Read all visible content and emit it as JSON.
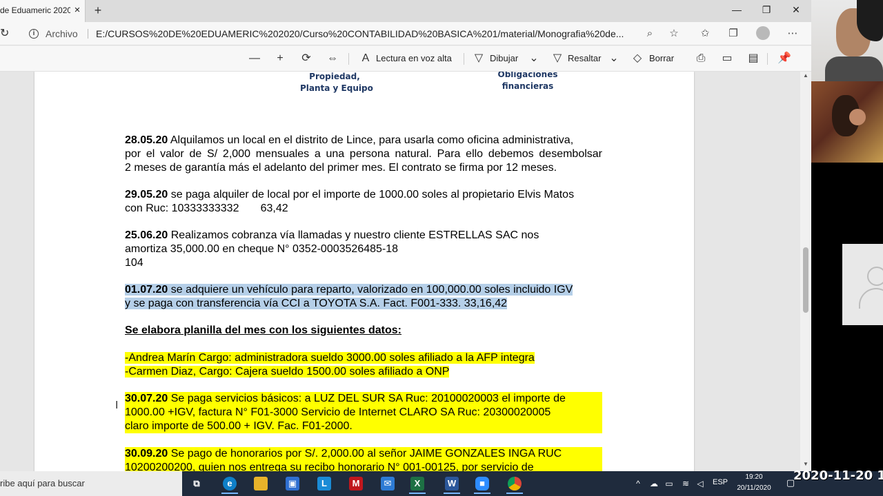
{
  "tab": {
    "title": "de Eduameric 2020",
    "close_glyph": "×",
    "new_tab_glyph": "+"
  },
  "window_controls": {
    "minimize": "—",
    "maximize": "❐",
    "close": "✕"
  },
  "address_bar": {
    "scheme_label": "Archivo",
    "url": "E:/CURSOS%20DE%20EDUAMERIC%202020/Curso%20CONTABILIDAD%20BASICA%201/material/Monografia%20de..."
  },
  "pdf_toolbar": {
    "zoom_out": "—",
    "zoom_in": "+",
    "read_aloud": "Lectura en voz alta",
    "draw": "Dibujar",
    "highlight": "Resaltar",
    "erase": "Borrar"
  },
  "document": {
    "diagram_labels": {
      "left": [
        "Propiedad,",
        "Planta y Equipo"
      ],
      "right": [
        "Obligaciones",
        "financieras"
      ]
    },
    "paragraphs": {
      "p1": {
        "date": "28.05.20",
        "line1": " Alquilamos un local en el distrito de Lince, para usarla como oficina administrativa,",
        "line2": "por el valor de S/ 2,000 mensuales a una persona natural. Para ello debemos desembolsar",
        "line3": "2 meses de garantía más el adelanto del primer mes. El contrato se firma por 12 meses."
      },
      "p2": {
        "date": "29.05.20",
        "line1": " se paga alquiler de local por el importe de 1000.00 soles al propietario Elvis Matos",
        "line2": "con Ruc: 10333333332       63,42"
      },
      "p3": {
        "date": "25.06.20",
        "line1": " Realizamos cobranza vía llamadas y nuestro cliente ESTRELLAS SAC nos",
        "line2": "amortiza 35,000.00 en cheque N° 0352-0003526485-18",
        "line3": "104"
      },
      "p4": {
        "date": "01.07.20",
        "line1": " se adquiere un vehículo para reparto, valorizado en 100,000.00 soles incluido IGV",
        "line2": "y se paga con transferencia vía CCI a TOYOTA S.A. Fact. F001-333. 33,16,42"
      },
      "heading": "Se elabora planilla del mes con los siguientes datos:",
      "p5": {
        "line1": "-Andrea Marín Cargo: administradora sueldo 3000.00 soles afiliado a la AFP integra",
        "line2": "-Carmen Diaz, Cargo: Cajera sueldo 1500.00 soles afiliado a ONP"
      },
      "p6": {
        "date": "30.07.20",
        "line1": " Se paga servicios básicos: a LUZ DEL SUR SA Ruc: 20100020003 el importe de",
        "line2": "1000.00 +IGV, factura N° F01-3000 Servicio de Internet CLARO SA Ruc: 20300020005",
        "line3": "claro importe de 500.00 + IGV. Fac. F01-2000."
      },
      "p7": {
        "date": "30.09.20",
        "line1": " Se pago de honorarios por S/. 2,000.00 al señor JAIME GONZALES INGA RUC",
        "line2": "10200200200, quien nos entrega su recibo honorario N° 001-00125, por servicio de"
      }
    }
  },
  "taskbar": {
    "search_text": "ribe aquí para buscar",
    "apps": [
      "task-view",
      "edge",
      "file-explorer",
      "store",
      "l-app",
      "mcafee",
      "mail",
      "excel",
      "word",
      "zoom",
      "chrome"
    ],
    "language": "ESP",
    "time": "19:20",
    "date": "20/11/2020"
  },
  "overlay": {
    "recording_date": "2020-11-20 1"
  },
  "colors": {
    "highlight_yellow": "#ffff00",
    "selection_blue": "#b5cfe8",
    "diagram_text": "#1f3864",
    "taskbar_bg": "#1f2b3d"
  }
}
